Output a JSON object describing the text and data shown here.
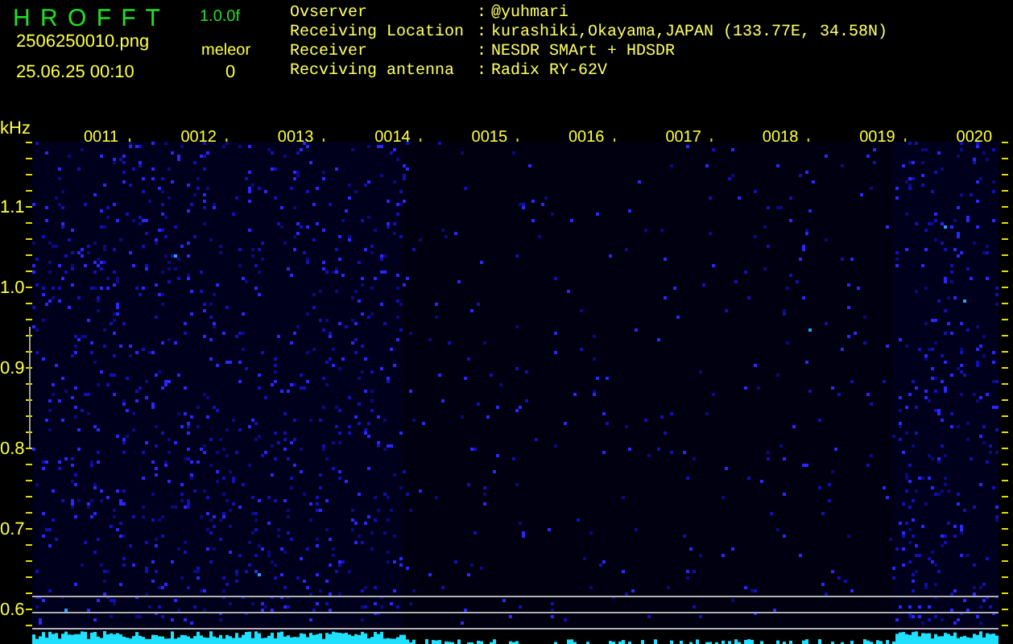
{
  "app": {
    "name": "H R O F F T",
    "version": "1.0.0f"
  },
  "file": {
    "name": "2506250010.png",
    "timestamp": "25.06.25 00:10"
  },
  "counter": {
    "label": "meleor",
    "value": "0"
  },
  "station_info": [
    {
      "label": "Ovserver",
      "separator": ":",
      "value": "@yuhmari"
    },
    {
      "label": "Receiving Location",
      "separator": ":",
      "value": "kurashiki,Okayama,JAPAN (133.77E, 34.58N)"
    },
    {
      "label": "Receiver",
      "separator": ":",
      "value": "NESDR SMArt + HDSDR"
    },
    {
      "label": "Recviving antenna",
      "separator": ":",
      "value": "Radix RY-62V"
    }
  ],
  "spectrogram": {
    "y_unit": "kHz",
    "y_ticks": [
      "1.1",
      "1.0",
      "0.9",
      "0.8",
      "0.7",
      "0.6"
    ],
    "x_ticks": [
      "0011",
      "0012",
      "0013",
      "0014",
      "0015",
      "0016",
      "0017",
      "0018",
      "0019",
      "0020"
    ]
  }
}
